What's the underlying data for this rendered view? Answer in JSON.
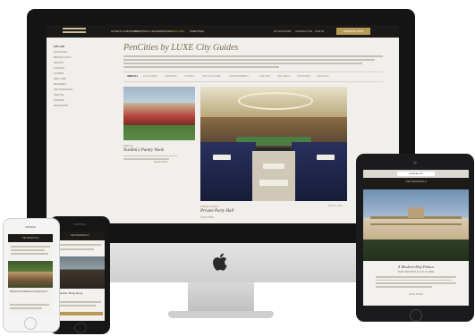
{
  "desktop": {
    "nav": {
      "items": [
        "HOTELS & RESORTS",
        "WEDDINGS & EXPERIENCES",
        "PENCITIES",
        "AMENITIES"
      ],
      "active_index": 2,
      "right_items": [
        "MY ACCOUNT",
        "CONTACT US",
        "LOG IN"
      ],
      "reserve_label": "RESERVE NOW"
    },
    "side_nav": [
      "CITY LIST",
      "ARLINGTON",
      "BEVERLY HILLS",
      "BOSTON",
      "CHICAGO",
      "FLORIDA",
      "NEW YORK",
      "PASADENA",
      "SAN FRANCISCO",
      "SEATTLE",
      "SONOMA",
      "WESTWOOD"
    ],
    "page_title": "PenCities by LUXE City Guides",
    "tabs": [
      "VIEW ALL",
      "EAT & DRINK",
      "SHOPPING",
      "FITNESS",
      "ART & CULTURE",
      "ENTERTAINMENT",
      "FOR KIDS",
      "WELLNESS",
      "OUTDOORS",
      "NIGHTLIFE"
    ],
    "cards": [
      {
        "tag": "DINING",
        "title": "Nardini's Pantry Nook",
        "more": "READ MORE"
      },
      {
        "tag": "DINING NOOK",
        "title": "Private Party Hall",
        "date": "MAY 12, 2016",
        "more": "READ MORE"
      }
    ]
  },
  "tablet": {
    "url": "peninsula.com",
    "logo": "THE PENINSULA",
    "article_title": "A Modern-Day Palace",
    "article_subtitle": "THE PENINSULA'S GUIDE",
    "more": "READ MORE"
  },
  "phone_white": {
    "logo": "THE PENINSULA",
    "article_title": "Hollywood Wellness Experience"
  },
  "phone_black": {
    "logo": "THE PENINSULA",
    "article_title": "Fantastic Hong Kong"
  },
  "colors": {
    "accent_gold": "#b89a56",
    "nav_dark": "#1c1a18",
    "page_bg": "#f1efec"
  },
  "icons": [
    "apple-logo-icon"
  ]
}
